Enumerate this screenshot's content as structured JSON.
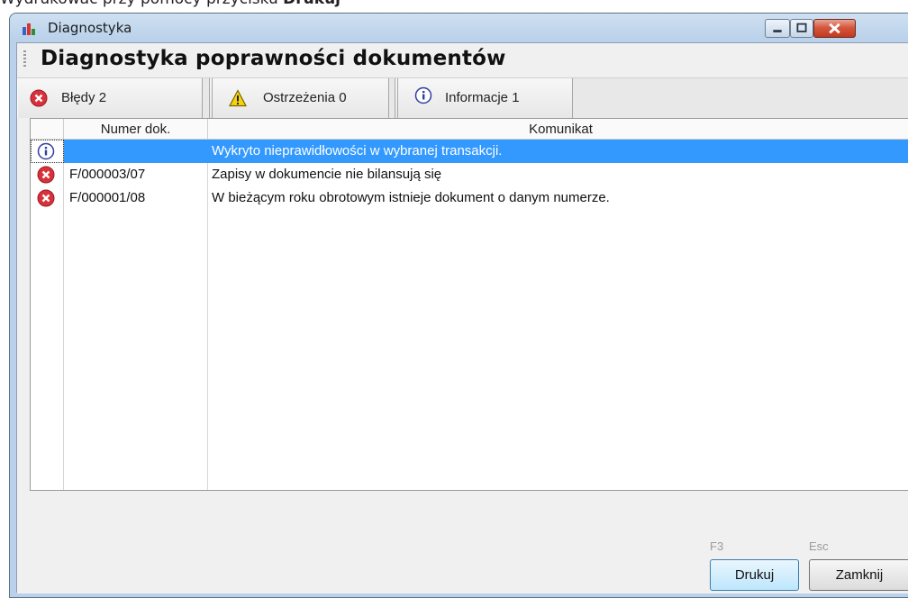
{
  "page_caption": {
    "prefix": "Wydrukować przy pomocy przycisku ",
    "bold": "Drukuj"
  },
  "window": {
    "title": "Diagnostyka"
  },
  "heading": "Diagnostyka poprawności dokumentów",
  "tabs": [
    {
      "label": "Błędy 2",
      "icon": "error-icon"
    },
    {
      "label": "Ostrzeżenia 0",
      "icon": "warning-icon"
    },
    {
      "label": "Informacje 1",
      "icon": "info-icon"
    }
  ],
  "table": {
    "columns": [
      "",
      "Numer dok.",
      "Komunikat"
    ],
    "rows": [
      {
        "type": "info",
        "number": "",
        "message": "Wykryto nieprawidłowości w wybranej transakcji.",
        "selected": true
      },
      {
        "type": "error",
        "number": "F/000003/07",
        "message": "Zapisy w dokumencie nie bilansują się",
        "selected": false
      },
      {
        "type": "error",
        "number": "F/000001/08",
        "message": "W bieżącym roku obrotowym istnieje dokument o danym numerze.",
        "selected": false
      }
    ]
  },
  "buttons": {
    "print": {
      "label": "Drukuj",
      "hotkey": "F3"
    },
    "close": {
      "label": "Zamknij",
      "hotkey": "Esc"
    }
  },
  "colors": {
    "selection": "#3399ff",
    "error": "#d8313b",
    "warning": "#f5d40f",
    "info": "#2f3fa0"
  }
}
